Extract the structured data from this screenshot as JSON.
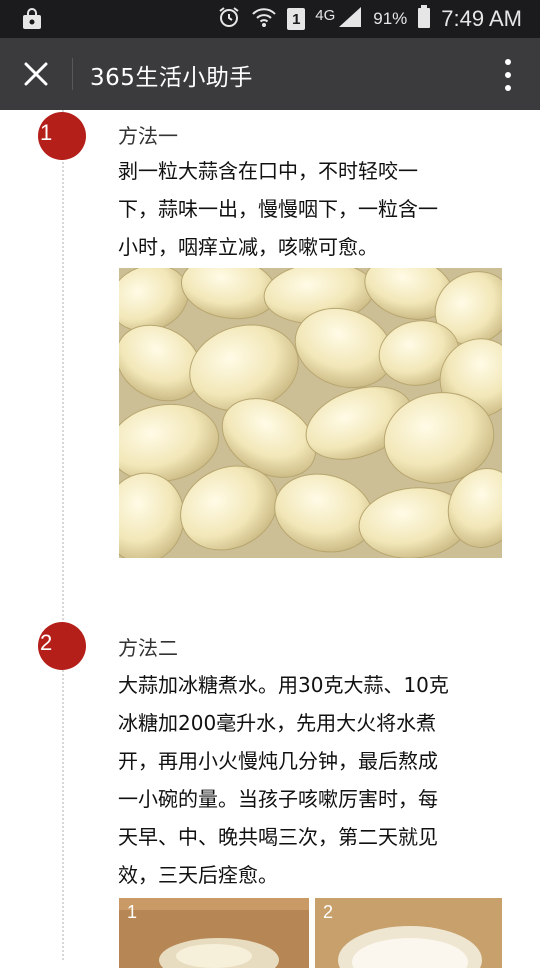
{
  "status_bar": {
    "network": "4G",
    "sim": "1",
    "battery": "91%",
    "time": "7:49 AM"
  },
  "header": {
    "title": "365生活小助手",
    "close_icon": "close-icon",
    "more_icon": "more-vertical-icon"
  },
  "steps": [
    {
      "number": "1",
      "title": "方法一",
      "lines": [
        "剥一粒大蒜含在口中，不时轻咬一",
        "下，蒜味一出，慢慢咽下，一粒含一",
        "小时，咽痒立减，咳嗽可愈。"
      ]
    },
    {
      "number": "2",
      "title": "方法二",
      "lines": [
        "大蒜加冰糖煮水。用30克大蒜、10克",
        "冰糖加200毫升水，先用大火将水煮",
        "开，再用小火慢炖几分钟，最后熬成",
        "一小碗的量。当孩子咳嗽厉害时，每",
        "天早、中、晚共喝三次，第二天就见",
        "效，三天后痊愈。"
      ],
      "photo_labels": [
        "1",
        "2"
      ]
    }
  ],
  "colors": {
    "status_bar": "#1b1b1d",
    "title_bar": "#3b3b3d",
    "badge": "#b51f1a"
  }
}
